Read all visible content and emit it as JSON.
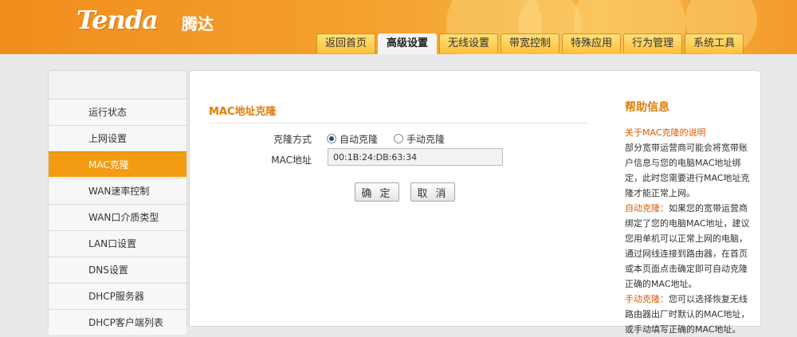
{
  "header": {
    "logo": "Tenda",
    "logo_cn": "腾达",
    "tabs": [
      "返回首页",
      "高级设置",
      "无线设置",
      "带宽控制",
      "特殊应用",
      "行为管理",
      "系统工具"
    ],
    "active_tab": "高级设置"
  },
  "sidebar": {
    "items": [
      "运行状态",
      "上网设置",
      "MAC克隆",
      "WAN速率控制",
      "WAN口介质类型",
      "LAN口设置",
      "DNS设置",
      "DHCP服务器",
      "DHCP客户端列表"
    ],
    "active": "MAC克隆"
  },
  "main": {
    "section_title": "MAC地址克隆",
    "clone_mode_label": "克隆方式",
    "option_auto": "自动克隆",
    "option_manual": "手动克隆",
    "selected_option": "自动克隆",
    "mac_label": "MAC地址",
    "mac_value": "00:1B:24:DB:63:34",
    "confirm_label": "确 定",
    "cancel_label": "取 消"
  },
  "help": {
    "title": "帮助信息",
    "subtitle": "关于MAC克隆的说明",
    "intro": "部分宽带运营商可能会将宽带账户信息与您的电脑MAC地址绑定，此时您需要进行MAC地址克隆才能正常上网。",
    "auto_term": "自动克隆：",
    "auto_text": "如果您的宽带运营商绑定了您的电脑MAC地址，建议您用单机可以正常上网的电脑，通过网线连接到路由器，在首页或本页面点击确定即可自动克隆正确的MAC地址。",
    "manual_term": "手动克隆：",
    "manual_text": "您可以选择恢复无线路由器出厂时默认的MAC地址，或手动填写正确的MAC地址。"
  },
  "colors": {
    "accent": "#f39c12",
    "header": "#f4a02e",
    "title": "#e07d00",
    "highlight": "#e05a00"
  }
}
